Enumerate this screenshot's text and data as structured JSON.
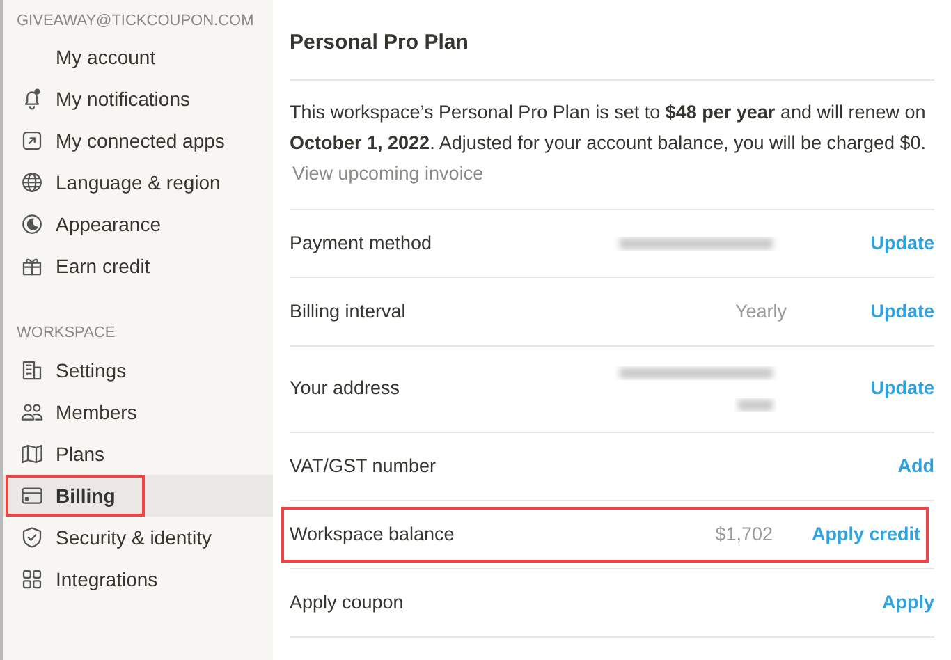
{
  "sidebar": {
    "account_header": "GIVEAWAY@TICKCOUPON.COM",
    "account_items": [
      {
        "label": "My account",
        "selected": false,
        "highlighted": false
      },
      {
        "label": "My notifications",
        "selected": false,
        "highlighted": false
      },
      {
        "label": "My connected apps",
        "selected": false,
        "highlighted": false
      },
      {
        "label": "Language & region",
        "selected": false,
        "highlighted": false
      },
      {
        "label": "Appearance",
        "selected": false,
        "highlighted": false
      },
      {
        "label": "Earn credit",
        "selected": false,
        "highlighted": false
      }
    ],
    "workspace_header": "WORKSPACE",
    "workspace_items": [
      {
        "label": "Settings",
        "selected": false,
        "highlighted": false
      },
      {
        "label": "Members",
        "selected": false,
        "highlighted": false
      },
      {
        "label": "Plans",
        "selected": false,
        "highlighted": false
      },
      {
        "label": "Billing",
        "selected": true,
        "highlighted": true
      },
      {
        "label": "Security & identity",
        "selected": false,
        "highlighted": false
      },
      {
        "label": "Integrations",
        "selected": false,
        "highlighted": false
      }
    ]
  },
  "main": {
    "title": "Personal Pro Plan",
    "description": "This workspace’s Personal Pro Plan is set to **$48 per year** and will renew on **October 1, 2022**. Adjusted for your account balance, you will be charged $0.",
    "invoice_link": "View upcoming invoice",
    "rows": [
      {
        "label": "Payment method",
        "kind": "blurred",
        "action": "Update",
        "highlighted": false
      },
      {
        "label": "Billing interval",
        "kind": "value",
        "value": "Yearly",
        "action": "Update",
        "highlighted": false
      },
      {
        "label": "Your address",
        "kind": "blurred_multiline",
        "action": "Update",
        "highlighted": false
      },
      {
        "label": "VAT/GST number",
        "kind": "empty",
        "action": "Add",
        "highlighted": false
      },
      {
        "label": "Workspace balance",
        "kind": "value",
        "value": "$1,702",
        "action": "Apply credit",
        "highlighted": true
      },
      {
        "label": "Apply coupon",
        "kind": "empty",
        "action": "Apply",
        "highlighted": false
      }
    ]
  }
}
